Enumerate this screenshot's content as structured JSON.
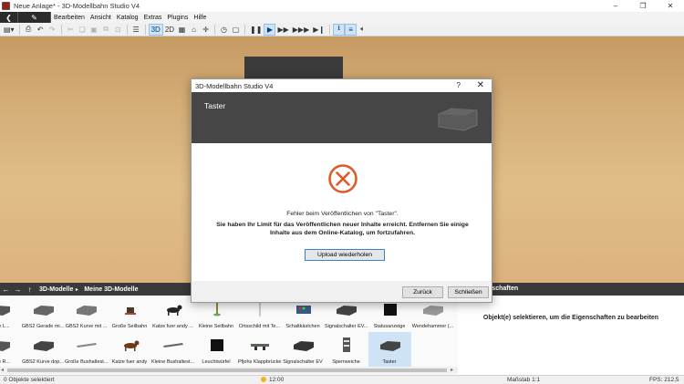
{
  "window": {
    "title": "Neue Anlage* - 3D-Modellbahn Studio V4",
    "controls": [
      "–",
      "❐",
      "✕"
    ]
  },
  "menu": {
    "items": [
      "Bearbeiten",
      "Ansicht",
      "Katalog",
      "Extras",
      "Plugins",
      "Hilfe"
    ]
  },
  "toolbar": {
    "view_3d": "3D",
    "view_2d": "2D"
  },
  "dialog": {
    "window_title": "3D-Modellbahn Studio V4",
    "help": "?",
    "close": "✕",
    "header_title": "Taster",
    "message_line1": "Fehler beim Veröffentlichen von \"Taster\".",
    "message_line2": "Sie haben Ihr Limit für das Veröffentlichen neuer Inhalte erreicht. Entfernen Sie einige",
    "message_line3": "Inhalte aus dem Online-Katalog, um fortzufahren.",
    "retry_button": "Upload wiederholen",
    "back_button": "Zurück",
    "close_button": "Schließen",
    "error_color": "#e05a2a"
  },
  "catalog": {
    "breadcrumb": [
      "3D-Modelle",
      "Meine 3D-Modelle"
    ],
    "row1": [
      "eiche L...",
      "GBS2 Gerade mi...",
      "GBS2 Kurve mit ...",
      "Große Seilbahn",
      "Katze fuer andy ...",
      "Kleine Seilbahn",
      "Ortsschild mit Te...",
      "Schaltkästchen",
      "Signalschalter EV...",
      "Statusanzeige",
      "Wendehammer (..."
    ],
    "row2": [
      "eiche R...",
      "GBS2 Kurve dop...",
      "Große Bushaltest...",
      "Katze fuer andy",
      "Kleine Bushaltest...",
      "Leuchtwürfel",
      "Pfjohs Klappbrücke",
      "Signalschalter EV",
      "Sperrweiche",
      "Taster"
    ]
  },
  "properties": {
    "header_title": "fschaften",
    "empty_message": "Objekt(e) selektieren, um die Eigenschaften zu bearbeiten"
  },
  "status": {
    "selection": "0 Objekte selektiert",
    "time": "12:00",
    "scale": "Maßstab 1:1",
    "fps": "FPS: 212,5"
  }
}
